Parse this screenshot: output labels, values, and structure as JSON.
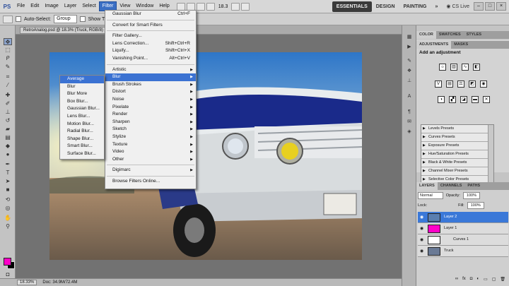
{
  "menubar": {
    "logo": "PS",
    "items": [
      "File",
      "Edit",
      "Image",
      "Layer",
      "Select",
      "Filter",
      "View",
      "Window",
      "Help"
    ],
    "active_index": 5,
    "zoom": "18.3",
    "workspaces": [
      "ESSENTIALS",
      "DESIGN",
      "PAINTING"
    ],
    "more": "»",
    "cs_live": "CS Live",
    "window_buttons": [
      "–",
      "□",
      "×"
    ]
  },
  "options": {
    "auto_select": "Auto-Select:",
    "group_value": "Group",
    "show_transform": "Show T"
  },
  "document": {
    "tab_title": "RetroAnalog.psd @ 18.3% (Truck, RGB/8)"
  },
  "status": {
    "zoom": "18.33%",
    "doc": "Doc: 34.9M/72.4M"
  },
  "filter_menu": {
    "items": [
      {
        "label": "Gaussian Blur",
        "shortcut": "Ctrl+F"
      },
      {
        "sep": true
      },
      {
        "label": "Convert for Smart Filters"
      },
      {
        "sep": true
      },
      {
        "label": "Filter Gallery..."
      },
      {
        "label": "Lens Correction...",
        "shortcut": "Shift+Ctrl+R"
      },
      {
        "label": "Liquify...",
        "shortcut": "Shift+Ctrl+X"
      },
      {
        "label": "Vanishing Point...",
        "shortcut": "Alt+Ctrl+V"
      },
      {
        "sep": true
      },
      {
        "label": "Artistic",
        "sub": true
      },
      {
        "label": "Blur",
        "sub": true,
        "highlight": true
      },
      {
        "label": "Brush Strokes",
        "sub": true
      },
      {
        "label": "Distort",
        "sub": true
      },
      {
        "label": "Noise",
        "sub": true
      },
      {
        "label": "Pixelate",
        "sub": true
      },
      {
        "label": "Render",
        "sub": true
      },
      {
        "label": "Sharpen",
        "sub": true
      },
      {
        "label": "Sketch",
        "sub": true
      },
      {
        "label": "Stylize",
        "sub": true
      },
      {
        "label": "Texture",
        "sub": true
      },
      {
        "label": "Video",
        "sub": true
      },
      {
        "label": "Other",
        "sub": true
      },
      {
        "sep": true
      },
      {
        "label": "Digimarc",
        "sub": true
      },
      {
        "sep": true
      },
      {
        "label": "Browse Filters Online..."
      }
    ]
  },
  "blur_submenu": {
    "items": [
      "Average",
      "Blur",
      "Blur More",
      "Box Blur...",
      "Gaussian Blur...",
      "Lens Blur...",
      "Motion Blur...",
      "Radial Blur...",
      "Shape Blur...",
      "Smart Blur...",
      "Surface Blur..."
    ],
    "highlight_index": 0
  },
  "panels": {
    "color_tabs": [
      "COLOR",
      "SWATCHES",
      "STYLES"
    ],
    "adjust_tabs": [
      "ADJUSTMENTS",
      "MASKS"
    ],
    "adjust_heading": "Add an adjustment",
    "presets": [
      "Levels Presets",
      "Curves Presets",
      "Exposure Presets",
      "Hue/Saturation Presets",
      "Black & White Presets",
      "Channel Mixer Presets",
      "Selective Color Presets"
    ],
    "layer_tabs": [
      "LAYERS",
      "CHANNELS",
      "PATHS"
    ],
    "blend_mode": "Normal",
    "opacity_label": "Opacity:",
    "opacity_value": "100%",
    "lock_label": "Lock:",
    "fill_label": "Fill:",
    "fill_value": "100%",
    "layers": [
      {
        "name": "Layer 2",
        "selected": true,
        "thumb": "#5a7fb0"
      },
      {
        "name": "Layer 1",
        "selected": false,
        "thumb": "#ff00c8"
      },
      {
        "name": "Curves 1",
        "selected": false,
        "thumb": "#ffffff"
      },
      {
        "name": "Truck",
        "selected": false,
        "thumb": "#6a7a95"
      }
    ]
  },
  "colors": {
    "foreground": "#ff00c8",
    "background": "#000000",
    "menu_highlight": "#3b72d2"
  }
}
